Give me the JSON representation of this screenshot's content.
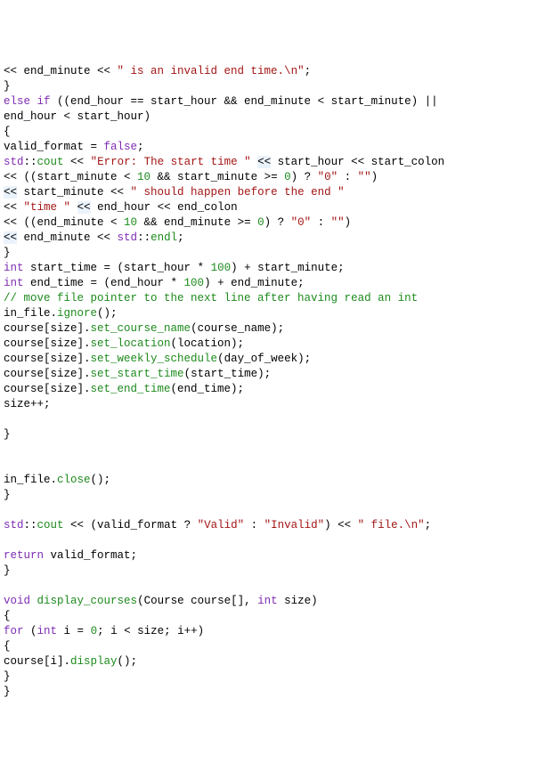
{
  "lines": [
    [
      {
        "t": "<< end_minute << ",
        "c": "",
        "hl": false
      },
      {
        "t": "\" is an invalid end time.\\n\"",
        "c": "str",
        "hl": false
      },
      {
        "t": ";",
        "c": "",
        "hl": false
      }
    ],
    [
      {
        "t": "}",
        "c": ""
      }
    ],
    [
      {
        "t": "else if",
        "c": "kwp"
      },
      {
        "t": " ((end_hour == start_hour && end_minute < start_minute) || ",
        "c": ""
      }
    ],
    [
      {
        "t": "end_hour < start_hour)",
        "c": ""
      }
    ],
    [
      {
        "t": "{",
        "c": ""
      }
    ],
    [
      {
        "t": "valid_format = ",
        "c": ""
      },
      {
        "t": "false",
        "c": "kwp"
      },
      {
        "t": ";",
        "c": ""
      }
    ],
    [
      {
        "t": "std",
        "c": "kwp"
      },
      {
        "t": "::",
        "c": ""
      },
      {
        "t": "cout",
        "c": "ns"
      },
      {
        "t": " << ",
        "c": ""
      },
      {
        "t": "\"Error: The start time \"",
        "c": "str"
      },
      {
        "t": " ",
        "c": ""
      },
      {
        "t": "<<",
        "c": "",
        "hl": true
      },
      {
        "t": " start_hour << start_colon",
        "c": ""
      }
    ],
    [
      {
        "t": "<< ((start_minute < ",
        "c": ""
      },
      {
        "t": "10",
        "c": "num"
      },
      {
        "t": " && start_minute >= ",
        "c": ""
      },
      {
        "t": "0",
        "c": "num"
      },
      {
        "t": ") ? ",
        "c": ""
      },
      {
        "t": "\"0\"",
        "c": "str"
      },
      {
        "t": " : ",
        "c": ""
      },
      {
        "t": "\"\"",
        "c": "str"
      },
      {
        "t": ")",
        "c": ""
      }
    ],
    [
      {
        "t": "<<",
        "c": "",
        "hl": true
      },
      {
        "t": " start_minute << ",
        "c": ""
      },
      {
        "t": "\" should happen before the end \"",
        "c": "str"
      }
    ],
    [
      {
        "t": "<< ",
        "c": ""
      },
      {
        "t": "\"time \"",
        "c": "str"
      },
      {
        "t": " ",
        "c": ""
      },
      {
        "t": "<<",
        "c": "",
        "hl": true
      },
      {
        "t": " end_hour << end_colon",
        "c": ""
      }
    ],
    [
      {
        "t": "<< ((end_minute < ",
        "c": ""
      },
      {
        "t": "10",
        "c": "num"
      },
      {
        "t": " && end_minute >= ",
        "c": ""
      },
      {
        "t": "0",
        "c": "num"
      },
      {
        "t": ") ? ",
        "c": ""
      },
      {
        "t": "\"0\"",
        "c": "str"
      },
      {
        "t": " : ",
        "c": ""
      },
      {
        "t": "\"\"",
        "c": "str"
      },
      {
        "t": ")",
        "c": ""
      }
    ],
    [
      {
        "t": "<<",
        "c": "",
        "hl": true
      },
      {
        "t": " end_minute << ",
        "c": ""
      },
      {
        "t": "std",
        "c": "kwp"
      },
      {
        "t": "::",
        "c": ""
      },
      {
        "t": "endl",
        "c": "ns"
      },
      {
        "t": ";",
        "c": ""
      }
    ],
    [
      {
        "t": "}",
        "c": ""
      }
    ],
    [
      {
        "t": "int",
        "c": "kwp"
      },
      {
        "t": " start_time = (start_hour * ",
        "c": ""
      },
      {
        "t": "100",
        "c": "num"
      },
      {
        "t": ") + start_minute;",
        "c": ""
      }
    ],
    [
      {
        "t": "int",
        "c": "kwp"
      },
      {
        "t": " end_time = (end_hour * ",
        "c": ""
      },
      {
        "t": "100",
        "c": "num"
      },
      {
        "t": ") + end_minute;",
        "c": ""
      }
    ],
    [
      {
        "t": "// move file pointer to the next line after having read an int",
        "c": "cmt"
      }
    ],
    [
      {
        "t": "in_file.",
        "c": ""
      },
      {
        "t": "ignore",
        "c": "fn"
      },
      {
        "t": "();",
        "c": ""
      }
    ],
    [
      {
        "t": "course[size].",
        "c": ""
      },
      {
        "t": "set_course_name",
        "c": "fn"
      },
      {
        "t": "(course_name);",
        "c": ""
      }
    ],
    [
      {
        "t": "course[size].",
        "c": ""
      },
      {
        "t": "set_location",
        "c": "fn"
      },
      {
        "t": "(location);",
        "c": ""
      }
    ],
    [
      {
        "t": "course[size].",
        "c": ""
      },
      {
        "t": "set_weekly_schedule",
        "c": "fn"
      },
      {
        "t": "(day_of_week);",
        "c": ""
      }
    ],
    [
      {
        "t": "course[size].",
        "c": ""
      },
      {
        "t": "set_start_time",
        "c": "fn"
      },
      {
        "t": "(start_time);",
        "c": ""
      }
    ],
    [
      {
        "t": "course[size].",
        "c": ""
      },
      {
        "t": "set_end_time",
        "c": "fn"
      },
      {
        "t": "(end_time);",
        "c": ""
      }
    ],
    [
      {
        "t": "size++;",
        "c": ""
      }
    ],
    [
      {
        "t": "",
        "c": ""
      }
    ],
    [
      {
        "t": "}",
        "c": ""
      }
    ],
    [
      {
        "t": "",
        "c": ""
      }
    ],
    [
      {
        "t": "",
        "c": ""
      }
    ],
    [
      {
        "t": "in_file.",
        "c": ""
      },
      {
        "t": "close",
        "c": "fn"
      },
      {
        "t": "();",
        "c": ""
      }
    ],
    [
      {
        "t": "}",
        "c": ""
      }
    ],
    [
      {
        "t": "",
        "c": ""
      }
    ],
    [
      {
        "t": "std",
        "c": "kwp"
      },
      {
        "t": "::",
        "c": ""
      },
      {
        "t": "cout",
        "c": "ns"
      },
      {
        "t": " << (valid_format ? ",
        "c": ""
      },
      {
        "t": "\"Valid\"",
        "c": "str"
      },
      {
        "t": " : ",
        "c": ""
      },
      {
        "t": "\"Invalid\"",
        "c": "str"
      },
      {
        "t": ") << ",
        "c": ""
      },
      {
        "t": "\" file.\\n\"",
        "c": "str"
      },
      {
        "t": ";",
        "c": ""
      }
    ],
    [
      {
        "t": "",
        "c": ""
      }
    ],
    [
      {
        "t": "return",
        "c": "kwp"
      },
      {
        "t": " valid_format;",
        "c": ""
      }
    ],
    [
      {
        "t": "}",
        "c": ""
      }
    ],
    [
      {
        "t": "",
        "c": ""
      }
    ],
    [
      {
        "t": "void",
        "c": "kwp"
      },
      {
        "t": " ",
        "c": ""
      },
      {
        "t": "display_courses",
        "c": "fn"
      },
      {
        "t": "(Course course[], ",
        "c": ""
      },
      {
        "t": "int",
        "c": "kwp"
      },
      {
        "t": " size)",
        "c": ""
      }
    ],
    [
      {
        "t": "{",
        "c": ""
      }
    ],
    [
      {
        "t": "for",
        "c": "kwp"
      },
      {
        "t": " (",
        "c": ""
      },
      {
        "t": "int",
        "c": "kwp"
      },
      {
        "t": " i = ",
        "c": ""
      },
      {
        "t": "0",
        "c": "num"
      },
      {
        "t": "; i < size; i++)",
        "c": ""
      }
    ],
    [
      {
        "t": "{",
        "c": ""
      }
    ],
    [
      {
        "t": "course[i].",
        "c": ""
      },
      {
        "t": "display",
        "c": "fn"
      },
      {
        "t": "();",
        "c": ""
      }
    ],
    [
      {
        "t": "}",
        "c": ""
      }
    ],
    [
      {
        "t": "}",
        "c": ""
      }
    ]
  ]
}
